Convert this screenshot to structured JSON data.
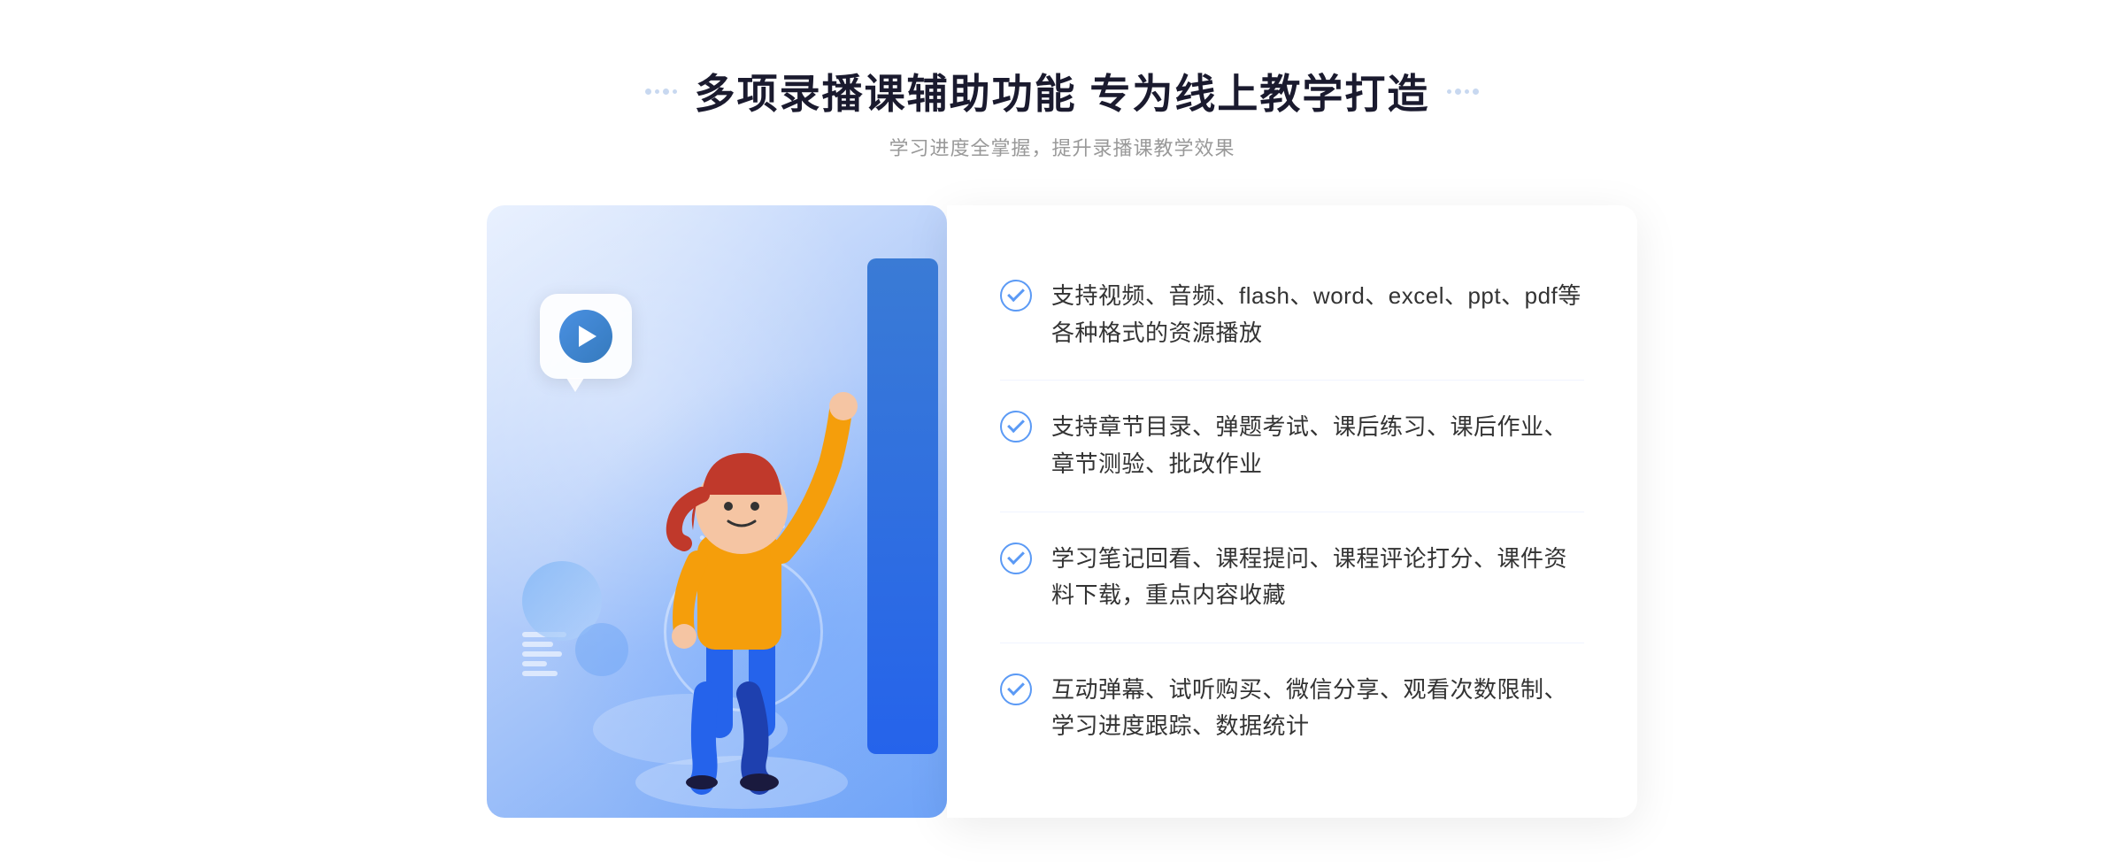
{
  "header": {
    "title_part1": "多项录播课辅助功能",
    "title_separator": " ",
    "title_part2": "专为线上教学打造",
    "subtitle": "学习进度全掌握，提升录播课教学效果"
  },
  "features": [
    {
      "id": 1,
      "text": "支持视频、音频、flash、word、excel、ppt、pdf等各种格式的资源播放"
    },
    {
      "id": 2,
      "text": "支持章节目录、弹题考试、课后练习、课后作业、章节测验、批改作业"
    },
    {
      "id": 3,
      "text": "学习笔记回看、课程提问、课程评论打分、课件资料下载，重点内容收藏"
    },
    {
      "id": 4,
      "text": "互动弹幕、试听购买、微信分享、观看次数限制、学习进度跟踪、数据统计"
    }
  ],
  "decoration": {
    "left_arrow": "»",
    "play_button_alt": "play"
  }
}
